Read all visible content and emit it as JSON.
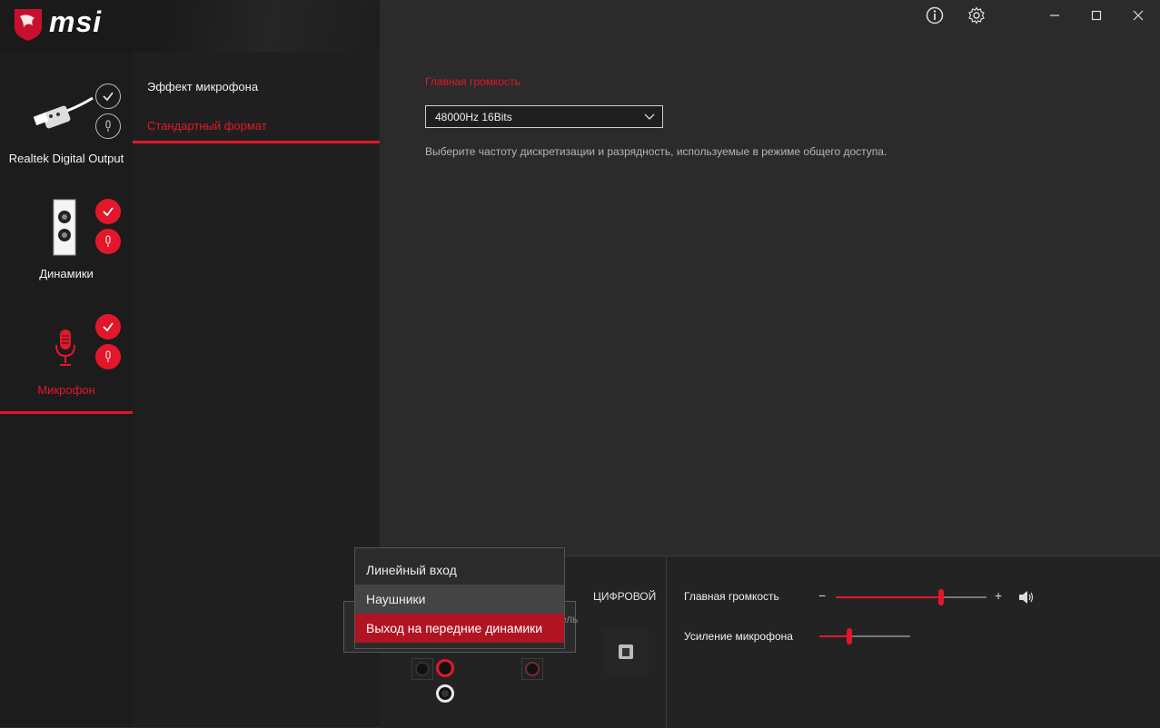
{
  "brand": {
    "logo_text": "msi"
  },
  "window": {
    "info_icon": "info-icon",
    "settings_icon": "gear-icon",
    "minimize": "–",
    "maximize": "☐",
    "close": "✕"
  },
  "devices": [
    {
      "label": "Realtek Digital Output",
      "icon": "optical-cable-icon",
      "active": false
    },
    {
      "label": "Динамики",
      "icon": "speaker-jack-icon",
      "active": false
    },
    {
      "label": "Микрофон",
      "icon": "microphone-icon",
      "active": true
    }
  ],
  "tabs": [
    {
      "label": "Эффект микрофона",
      "active": false
    },
    {
      "label": "Стандартный формат",
      "active": true
    }
  ],
  "main": {
    "section_title": "Главная громкость",
    "format_select_value": "48000Hz 16Bits",
    "description": "Выберите частоту дискретизации и разрядность, используемые в режиме общего доступа."
  },
  "dropdown_menu": {
    "items": [
      {
        "label": "Линейный вход",
        "state": "normal"
      },
      {
        "label": "Наушники",
        "state": "hover"
      },
      {
        "label": "Выход на передние динамики",
        "state": "selected"
      }
    ],
    "partial_label": "ель"
  },
  "bottom": {
    "digital_label": "ЦИФРОВОЙ",
    "master_volume_label": "Главная громкость",
    "master_volume_level": 0.7,
    "mic_boost_label": "Усиление микрофона",
    "mic_boost_level": 0.33,
    "minus": "−",
    "plus": "+"
  },
  "colors": {
    "accent": "#e3172b",
    "background": "#2b2b2b",
    "sidebar": "#1c1c1c"
  }
}
